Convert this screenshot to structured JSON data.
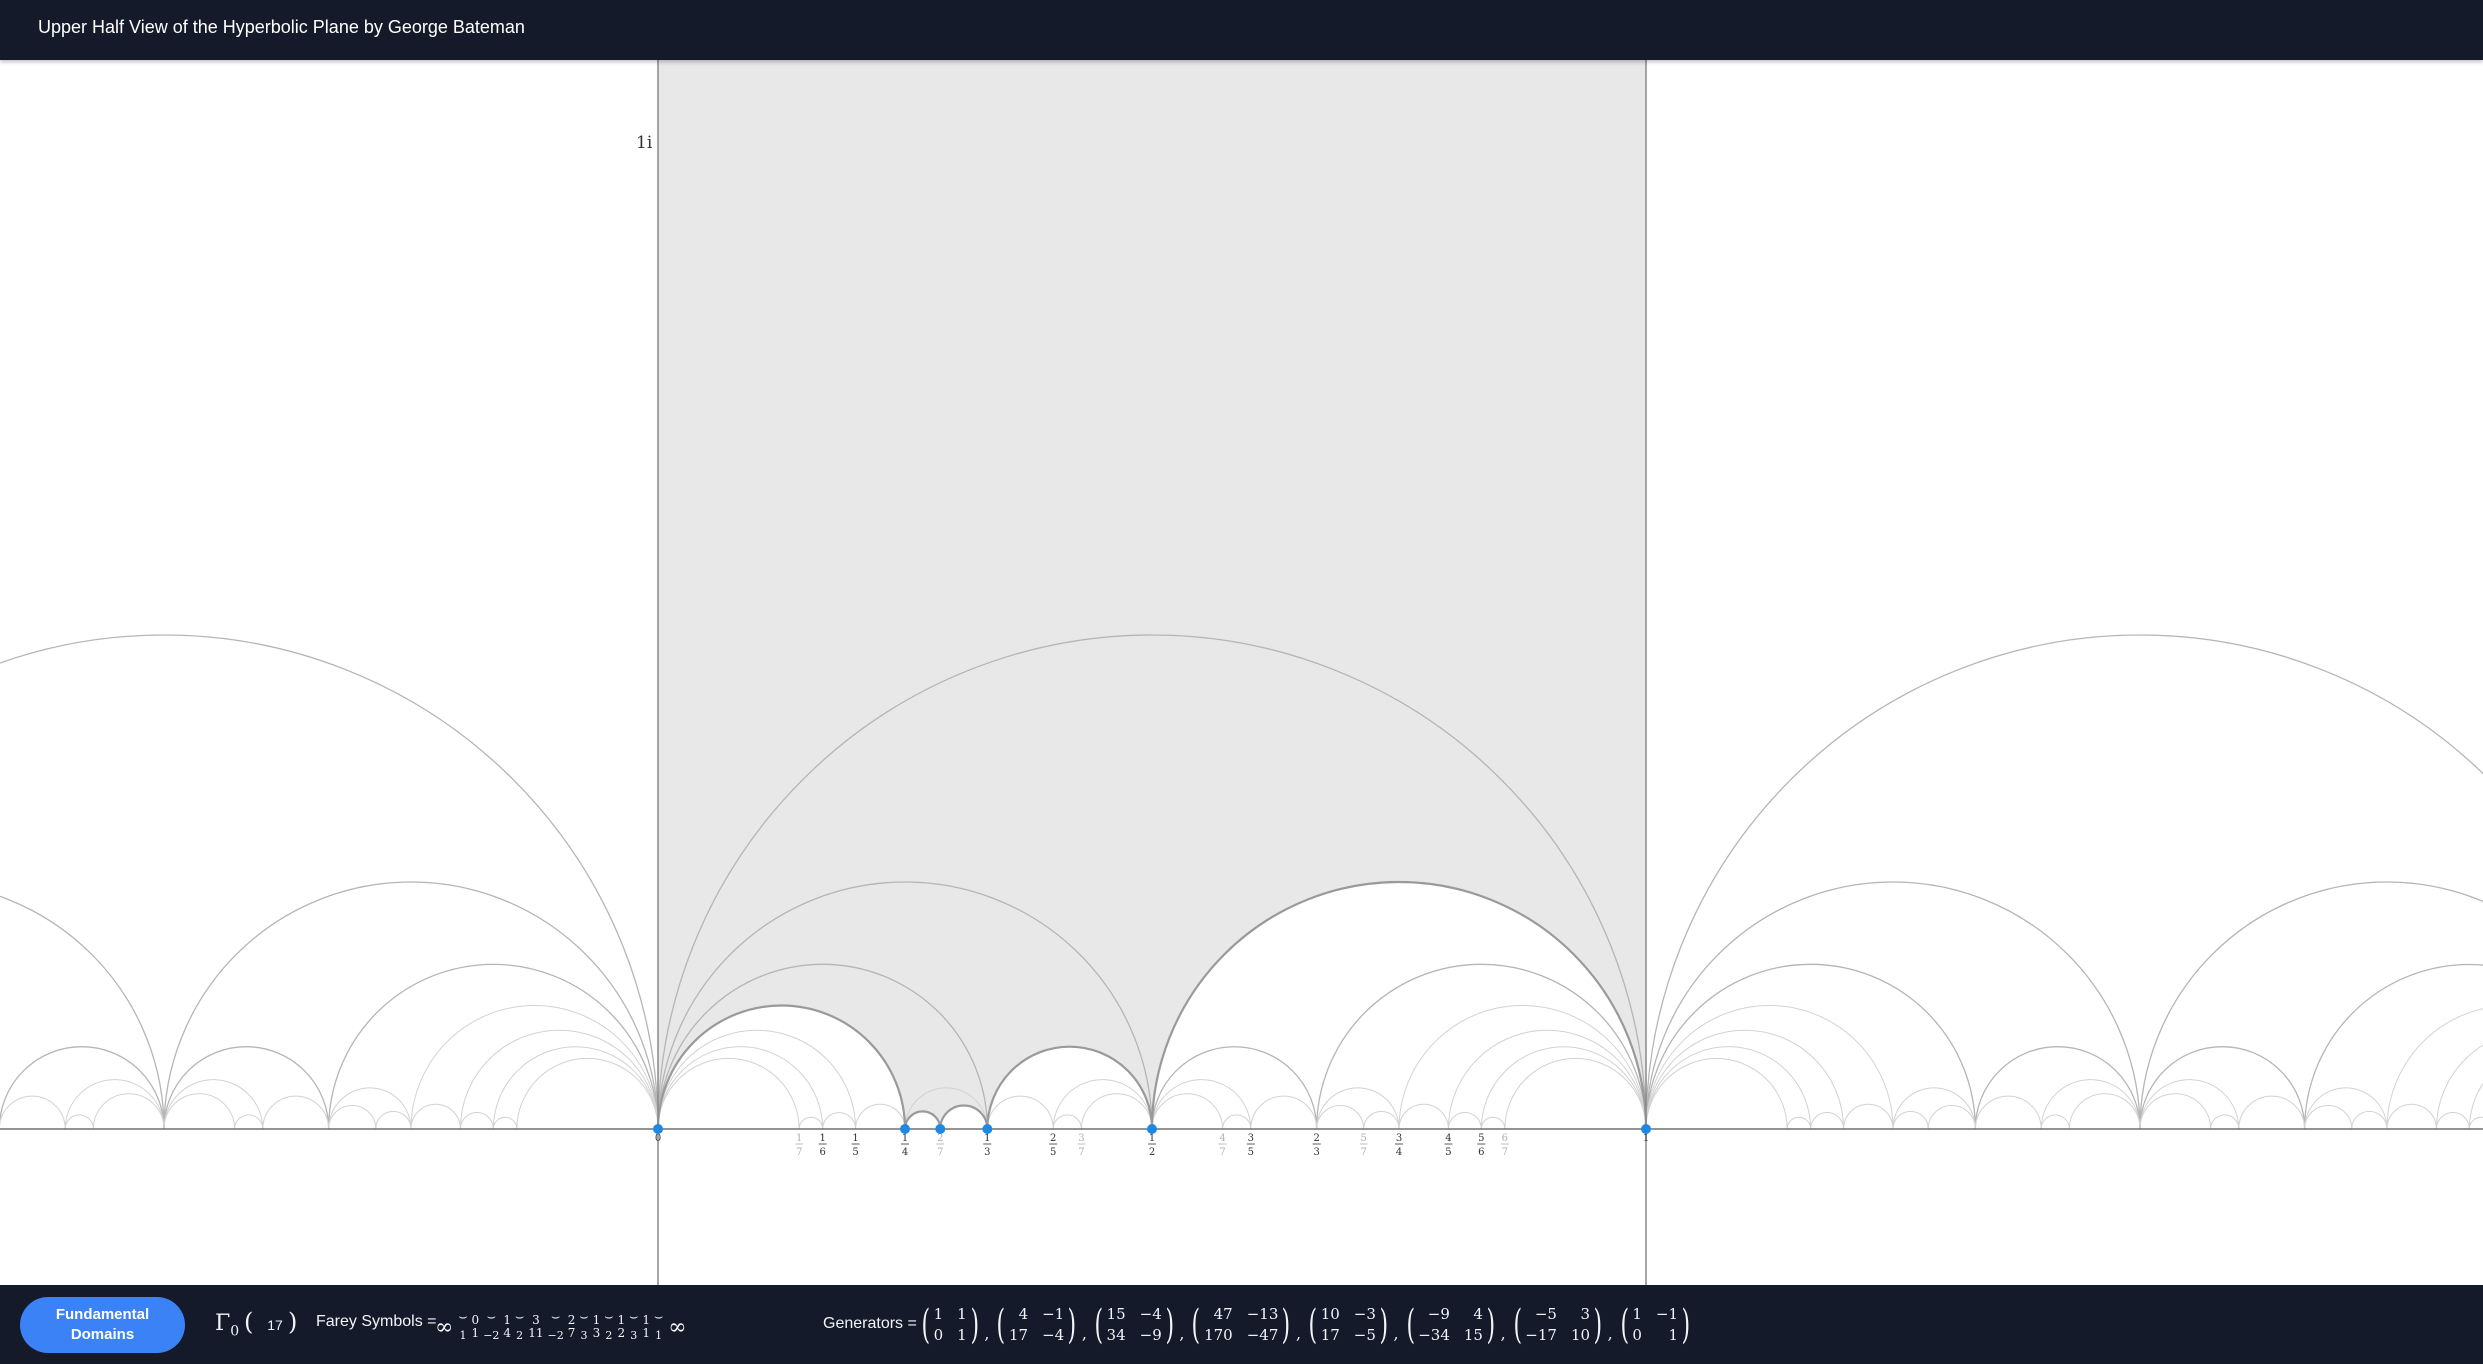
{
  "app_title": "Upper Half View of the Hyperbolic Plane by George Bateman",
  "plot": {
    "imaginary_marker": "1i",
    "colors": {
      "background": "#ffffff",
      "fundamental_domain_fill": "#e8e8e8",
      "strong_arc": "#9a9a9a",
      "faint_arc": "#d2d2d2",
      "axis": "#555555",
      "cusp_point": "#1e88e5",
      "bars": "#141a2a"
    },
    "cusps": [
      "0",
      "1/4",
      "2/7",
      "1/3",
      "1/2",
      "1"
    ],
    "tick_labels": [
      {
        "num": "0",
        "den": "",
        "x": 0,
        "faint": false
      },
      {
        "num": "1",
        "den": "7",
        "x": 0.142857,
        "faint": true
      },
      {
        "num": "1",
        "den": "6",
        "x": 0.166667,
        "faint": false
      },
      {
        "num": "1",
        "den": "5",
        "x": 0.2,
        "faint": false
      },
      {
        "num": "1",
        "den": "4",
        "x": 0.25,
        "faint": false
      },
      {
        "num": "2",
        "den": "7",
        "x": 0.285714,
        "faint": true
      },
      {
        "num": "1",
        "den": "3",
        "x": 0.333333,
        "faint": false
      },
      {
        "num": "2",
        "den": "5",
        "x": 0.4,
        "faint": false
      },
      {
        "num": "3",
        "den": "7",
        "x": 0.428571,
        "faint": true
      },
      {
        "num": "1",
        "den": "2",
        "x": 0.5,
        "faint": false
      },
      {
        "num": "4",
        "den": "7",
        "x": 0.571429,
        "faint": true
      },
      {
        "num": "3",
        "den": "5",
        "x": 0.6,
        "faint": false
      },
      {
        "num": "2",
        "den": "3",
        "x": 0.666667,
        "faint": false
      },
      {
        "num": "5",
        "den": "7",
        "x": 0.714286,
        "faint": true
      },
      {
        "num": "3",
        "den": "4",
        "x": 0.75,
        "faint": false
      },
      {
        "num": "4",
        "den": "5",
        "x": 0.8,
        "faint": false
      },
      {
        "num": "5",
        "den": "6",
        "x": 0.833333,
        "faint": false
      },
      {
        "num": "6",
        "den": "7",
        "x": 0.857143,
        "faint": true
      },
      {
        "num": "1",
        "den": "",
        "x": 1,
        "faint": false
      }
    ]
  },
  "bottom_bar": {
    "fundamental_domains_button": "Fundamental Domains",
    "gamma_symbol": "Γ",
    "gamma_sub": "0",
    "paren_open": "(",
    "paren_close": ")",
    "level_value": "17",
    "farey_label": "Farey Symbols =",
    "farey_sequence": [
      {
        "type": "inf",
        "text": "∞"
      },
      {
        "type": "cup",
        "text": "1"
      },
      {
        "type": "frac",
        "num": "0",
        "den": "1"
      },
      {
        "type": "cup",
        "text": "−2"
      },
      {
        "type": "frac",
        "num": "1",
        "den": "4"
      },
      {
        "type": "cup",
        "text": "2"
      },
      {
        "type": "frac",
        "num": "3",
        "den": "11"
      },
      {
        "type": "cup",
        "text": "−2"
      },
      {
        "type": "frac",
        "num": "2",
        "den": "7"
      },
      {
        "type": "cup",
        "text": "3"
      },
      {
        "type": "frac",
        "num": "1",
        "den": "3"
      },
      {
        "type": "cup",
        "text": "2"
      },
      {
        "type": "frac",
        "num": "1",
        "den": "2"
      },
      {
        "type": "cup",
        "text": "3"
      },
      {
        "type": "frac",
        "num": "1",
        "den": "1"
      },
      {
        "type": "cup",
        "text": "1"
      },
      {
        "type": "inf",
        "text": "∞"
      }
    ],
    "generators_label": "Generators =",
    "generators": [
      {
        "a": "1",
        "b": "1",
        "c": "0",
        "d": "1"
      },
      {
        "a": "4",
        "b": "−1",
        "c": "17",
        "d": "−4"
      },
      {
        "a": "15",
        "b": "−4",
        "c": "34",
        "d": "−9"
      },
      {
        "a": "47",
        "b": "−13",
        "c": "170",
        "d": "−47"
      },
      {
        "a": "10",
        "b": "−3",
        "c": "17",
        "d": "−5"
      },
      {
        "a": "−9",
        "b": "4",
        "c": "−34",
        "d": "15"
      },
      {
        "a": "−5",
        "b": "3",
        "c": "−17",
        "d": "10"
      },
      {
        "a": "1",
        "b": "−1",
        "c": "0",
        "d": "1"
      }
    ]
  }
}
